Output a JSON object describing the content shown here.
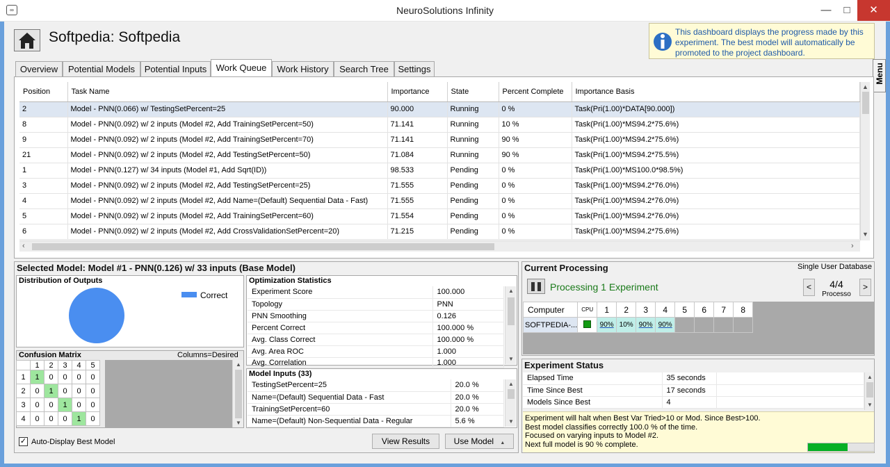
{
  "window": {
    "title": "NeuroSolutions Infinity",
    "controls": [
      "—",
      "□",
      "✕"
    ]
  },
  "page": {
    "title": "Softpedia:  Softpedia"
  },
  "info": {
    "text": "This dashboard displays the progress made by this experiment. The best model will automatically be promoted to the project dashboard."
  },
  "menu_tab": "Menu",
  "tabs": [
    {
      "label": "Overview"
    },
    {
      "label": "Potential Models"
    },
    {
      "label": "Potential Inputs"
    },
    {
      "label": "Work Queue"
    },
    {
      "label": "Work History"
    },
    {
      "label": "Search Tree"
    },
    {
      "label": "Settings"
    }
  ],
  "queue": {
    "headers": [
      "Position",
      "Task Name",
      "Importance",
      "State",
      "Percent Complete",
      "Importance Basis"
    ],
    "rows": [
      [
        "2",
        "Model - PNN(0.066) w/ TestingSetPercent=25",
        "90.000",
        "Running",
        "0 %",
        "Task(Pri(1.00)*DATA[90.000])"
      ],
      [
        "8",
        "Model - PNN(0.092) w/ 2 inputs (Model #2, Add TrainingSetPercent=50)",
        "71.141",
        "Running",
        "10 %",
        "Task(Pri(1.00)*MS94.2*75.6%)"
      ],
      [
        "9",
        "Model - PNN(0.092) w/ 2 inputs (Model #2, Add TrainingSetPercent=70)",
        "71.141",
        "Running",
        "90 %",
        "Task(Pri(1.00)*MS94.2*75.6%)"
      ],
      [
        "21",
        "Model - PNN(0.092) w/ 2 inputs (Model #2, Add TestingSetPercent=50)",
        "71.084",
        "Running",
        "90 %",
        "Task(Pri(1.00)*MS94.2*75.5%)"
      ],
      [
        "1",
        "Model - PNN(0.127) w/ 34 inputs (Model #1, Add Sqrt(ID))",
        "98.533",
        "Pending",
        "0 %",
        "Task(Pri(1.00)*MS100.0*98.5%)"
      ],
      [
        "3",
        "Model - PNN(0.092) w/ 2 inputs (Model #2, Add TestingSetPercent=25)",
        "71.555",
        "Pending",
        "0 %",
        "Task(Pri(1.00)*MS94.2*76.0%)"
      ],
      [
        "4",
        "Model - PNN(0.092) w/ 2 inputs (Model #2, Add Name=(Default) Sequential Data - Fast)",
        "71.555",
        "Pending",
        "0 %",
        "Task(Pri(1.00)*MS94.2*76.0%)"
      ],
      [
        "5",
        "Model - PNN(0.092) w/ 2 inputs (Model #2, Add TrainingSetPercent=60)",
        "71.554",
        "Pending",
        "0 %",
        "Task(Pri(1.00)*MS94.2*76.0%)"
      ],
      [
        "6",
        "Model - PNN(0.092) w/ 2 inputs (Model #2, Add CrossValidationSetPercent=20)",
        "71.215",
        "Pending",
        "0 %",
        "Task(Pri(1.00)*MS94.2*75.6%)"
      ]
    ]
  },
  "selected_model": {
    "title": "Selected Model: Model #1 - PNN(0.126) w/ 33 inputs (Base Model)",
    "distribution": {
      "title": "Distribution of Outputs",
      "legend": "Correct",
      "color": "#4a8ef0"
    },
    "confusion": {
      "title": "Confusion Matrix",
      "note": "Columns=Desired",
      "cols": [
        "1",
        "2",
        "3",
        "4",
        "5"
      ],
      "rows": [
        {
          "label": "1",
          "cells": [
            "1",
            "0",
            "0",
            "0",
            "0"
          ]
        },
        {
          "label": "2",
          "cells": [
            "0",
            "1",
            "0",
            "0",
            "0"
          ]
        },
        {
          "label": "3",
          "cells": [
            "0",
            "0",
            "1",
            "0",
            "0"
          ]
        },
        {
          "label": "4",
          "cells": [
            "0",
            "0",
            "0",
            "1",
            "0"
          ]
        }
      ]
    },
    "optimization": {
      "title": "Optimization Statistics",
      "rows": [
        [
          "Experiment Score",
          "100.000"
        ],
        [
          "Topology",
          "PNN"
        ],
        [
          "PNN Smoothing",
          "0.126"
        ],
        [
          "Percent Correct",
          "100.000 %"
        ],
        [
          "Avg. Class Correct",
          "100.000 %"
        ],
        [
          "Avg. Area ROC",
          "1.000"
        ],
        [
          "Avg. Correlation",
          "1.000"
        ]
      ]
    },
    "inputs": {
      "title": "Model Inputs (33)",
      "rows": [
        [
          "TestingSetPercent=25",
          "20.0 %"
        ],
        [
          "Name=(Default) Sequential Data - Fast",
          "20.0 %"
        ],
        [
          "TrainingSetPercent=60",
          "20.0 %"
        ],
        [
          "Name=(Default) Non-Sequential Data - Regular",
          "5.6 %"
        ]
      ]
    },
    "auto_display": "Auto-Display Best Model",
    "view_results": "View Results",
    "use_model": "Use Model"
  },
  "current": {
    "title": "Current Processing",
    "database": "Single User Database",
    "status": "Processing 1 Experiment",
    "status_color": "#1a7a1a",
    "count": "4/4",
    "processors_label": "Processo",
    "prev": "<",
    "next": ">",
    "headers": [
      "Computer",
      "CPU",
      "1",
      "2",
      "3",
      "4",
      "5",
      "6",
      "7",
      "8"
    ],
    "computer": "SOFTPEDIA-...",
    "cpu_values": [
      "90%",
      "10%",
      "90%",
      "90%"
    ]
  },
  "experiment": {
    "title": "Experiment Status",
    "rows": [
      [
        "Elapsed Time",
        "35 seconds"
      ],
      [
        "Time Since Best",
        "17 seconds"
      ],
      [
        "Models Since Best",
        "4"
      ]
    ],
    "notes": [
      "Experiment will halt when Best Var Tried>10 or Mod. Since Best>100.",
      "Best model classifies correctly 100.0 % of the time.",
      "Focused on varying inputs to Model #2.",
      "Next full model is 90 % complete."
    ],
    "progress": 0.6
  }
}
